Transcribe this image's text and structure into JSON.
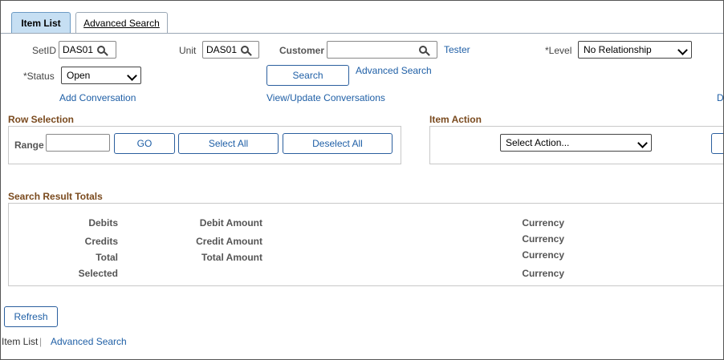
{
  "tabs": [
    {
      "label": "Item List",
      "active": true
    },
    {
      "label": "Advanced Search",
      "active": false
    }
  ],
  "criteria": {
    "setid_label": "SetID",
    "setid_value": "DAS01",
    "unit_label": "Unit",
    "unit_value": "DAS01",
    "customer_label": "Customer",
    "customer_value": "",
    "customer_name": "Tester",
    "level_label": "*Level",
    "level_value": "No Relationship",
    "status_label": "*Status",
    "status_value": "Open",
    "search_button": "Search",
    "advanced_search_link": "Advanced Search",
    "add_conversation_link": "Add Conversation",
    "view_update_link": "View/Update Conversations",
    "truncated_right_link": "D"
  },
  "row_selection": {
    "title": "Row Selection",
    "range_label": "Range",
    "range_value": "",
    "go_button": "GO",
    "select_all_button": "Select All",
    "deselect_all_button": "Deselect All"
  },
  "item_action": {
    "title": "Item Action",
    "select_value": "Select Action..."
  },
  "totals": {
    "title": "Search Result Totals",
    "rows": [
      {
        "label": "Debits",
        "amount_label": "Debit Amount",
        "currency_label": "Currency"
      },
      {
        "label": "Credits",
        "amount_label": "Credit Amount",
        "currency_label": "Currency"
      },
      {
        "label": "Total",
        "amount_label": "Total Amount",
        "currency_label": "Currency"
      },
      {
        "label": "Selected",
        "amount_label": "",
        "currency_label": "Currency"
      }
    ]
  },
  "footer": {
    "refresh_button": "Refresh",
    "item_list_label": "Item List",
    "separator": "|",
    "advanced_search_link": "Advanced Search"
  },
  "colors": {
    "accent_link": "#1f5fa6",
    "section_title": "#7a4a1e",
    "active_tab": "#c6dff3"
  }
}
